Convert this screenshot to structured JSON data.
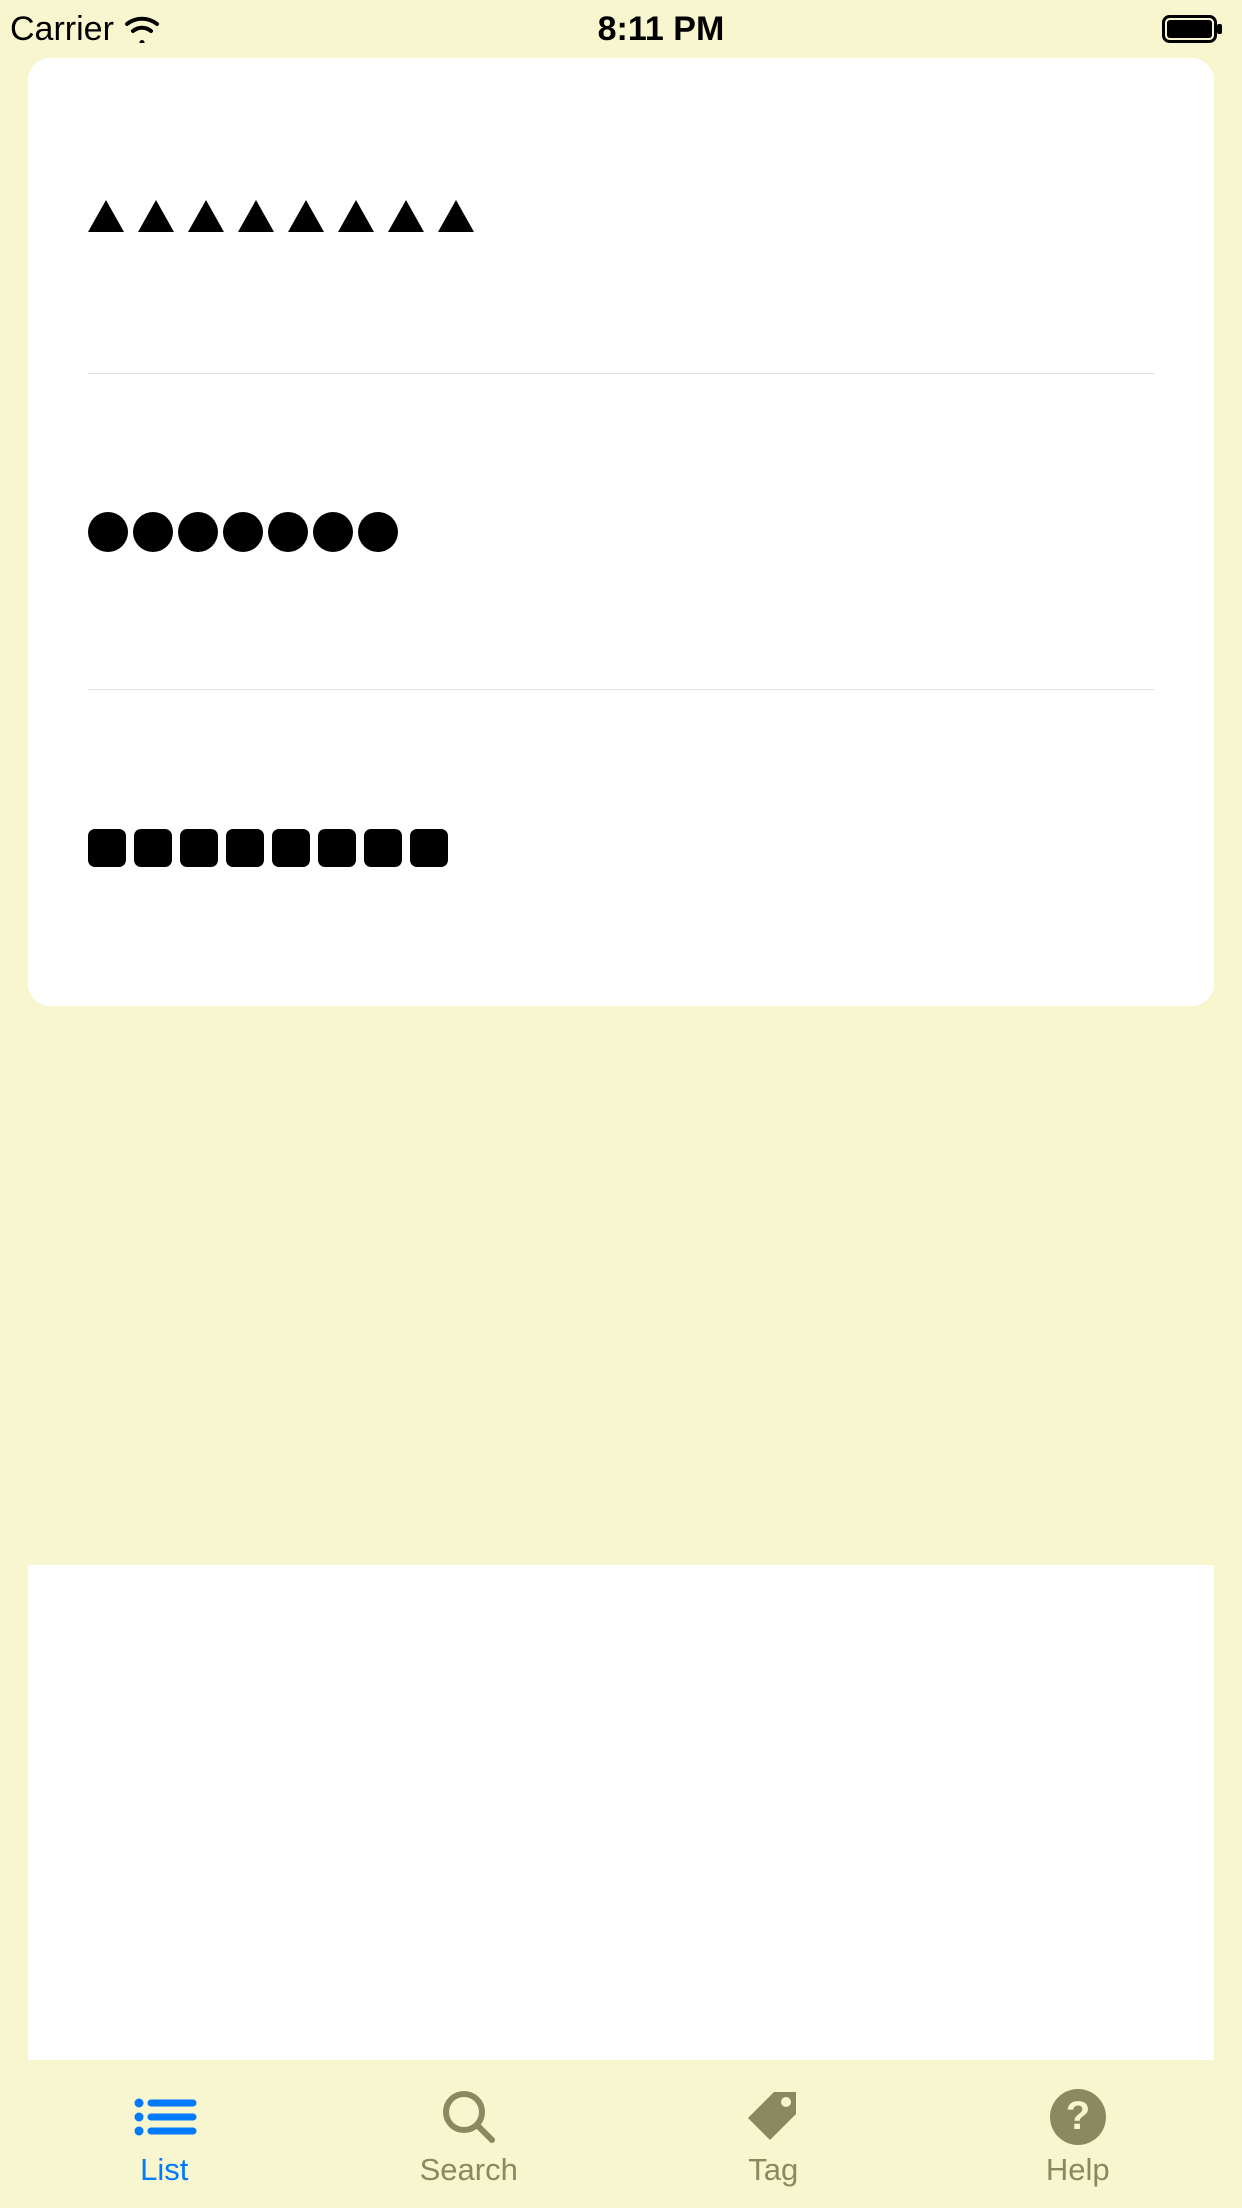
{
  "status_bar": {
    "carrier": "Carrier",
    "time": "8:11 PM"
  },
  "card": {
    "rows": [
      {
        "shape": "triangle",
        "count": 8
      },
      {
        "shape": "circle",
        "count": 7
      },
      {
        "shape": "square",
        "count": 8
      }
    ]
  },
  "tabs": [
    {
      "id": "list",
      "label": "List",
      "icon": "list-icon",
      "active": true
    },
    {
      "id": "search",
      "label": "Search",
      "icon": "search-icon",
      "active": false
    },
    {
      "id": "tag",
      "label": "Tag",
      "icon": "tag-icon",
      "active": false
    },
    {
      "id": "help",
      "label": "Help",
      "icon": "help-icon",
      "active": false
    }
  ],
  "colors": {
    "background": "#f7f6cf",
    "card": "#ffffff",
    "accent": "#007aff",
    "inactive": "#8b8960"
  }
}
